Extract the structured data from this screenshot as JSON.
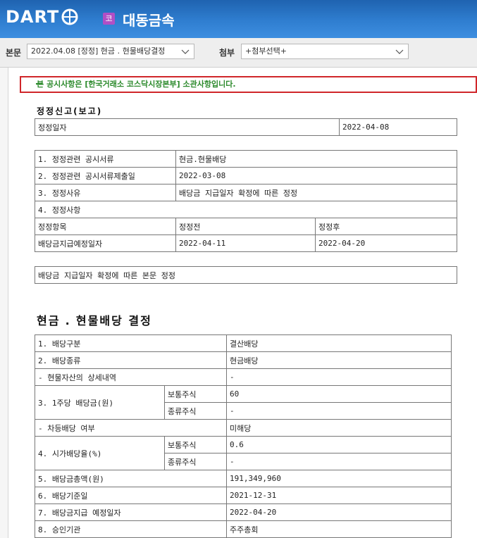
{
  "header": {
    "logo_text": "DART",
    "corp_badge": "코",
    "corp_name": "대동금속"
  },
  "toolbar": {
    "body_label": "본문",
    "body_select_value": "2022.04.08 [정정] 현금 ․ 현물배당결정",
    "attach_label": "첨부",
    "attach_select_value": "+첨부선택+"
  },
  "notice": {
    "text": "본 공시사항은 [한국거래소 코스닥시장본부] 소관사항입니다."
  },
  "correction": {
    "title": "정정신고(보고)",
    "date_label": "정정일자",
    "date_value": "2022-04-08",
    "rows": [
      {
        "label": "1. 정정관련 공시서류",
        "value": "현금.현물배당"
      },
      {
        "label": "2. 정정관련 공시서류제출일",
        "value": "2022-03-08"
      },
      {
        "label": "3. 정정사유",
        "value": "배당금 지급일자 확정에 따른 정정"
      }
    ],
    "item4_label": "4. 정정사항",
    "headers": [
      "정정항목",
      "정정전",
      "정정후"
    ],
    "change_row": [
      "배당금지급예정일자",
      "2022-04-11",
      "2022-04-20"
    ],
    "note": "배당금 지급일자 확정에 따른 본문 정정"
  },
  "dividend": {
    "title": "현금 ․ 현물배당 결정",
    "r1": {
      "label": "1. 배당구분",
      "value": "결산배당"
    },
    "r2": {
      "label": "2. 배당종류",
      "value": "현금배당"
    },
    "r_detail": {
      "label": "- 현물자산의 상세내역",
      "value": "-"
    },
    "r3": {
      "label": "3. 1주당 배당금(원)",
      "common_label": "보통주식",
      "common_value": "60",
      "pref_label": "종류주식",
      "pref_value": "-"
    },
    "r_diff": {
      "label": "- 차등배당 여부",
      "value": "미해당"
    },
    "r4": {
      "label": "4. 시가배당율(%)",
      "common_label": "보통주식",
      "common_value": "0.6",
      "pref_label": "종류주식",
      "pref_value": "-"
    },
    "r5": {
      "label": "5. 배당금총액(원)",
      "value": "191,349,960"
    },
    "r6": {
      "label": "6. 배당기준일",
      "value": "2021-12-31"
    },
    "r7": {
      "label": "7. 배당금지급 예정일자",
      "value": "2022-04-20"
    },
    "r8": {
      "label": "8. 승인기관",
      "value": "주주총회"
    }
  }
}
